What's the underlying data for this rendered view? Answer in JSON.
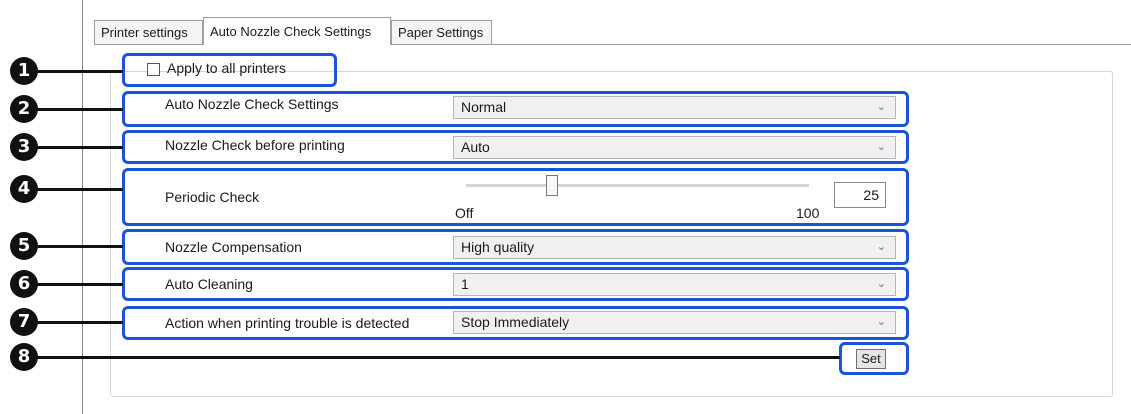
{
  "tabs": [
    {
      "label": "Printer settings",
      "active": false
    },
    {
      "label": "Auto Nozzle Check Settings",
      "active": true
    },
    {
      "label": "Paper Settings",
      "active": false
    }
  ],
  "apply_all": {
    "label": "Apply to all printers",
    "checked": false
  },
  "rows": {
    "auto_nozzle": {
      "label": "Auto Nozzle Check Settings",
      "value": "Normal"
    },
    "nozzle_check": {
      "label": "Nozzle Check before printing",
      "value": "Auto"
    },
    "periodic": {
      "label": "Periodic Check",
      "value": "25",
      "min_label": "Off",
      "max_label": "100",
      "slider_fraction": 0.25
    },
    "compensation": {
      "label": "Nozzle Compensation",
      "value": "High quality"
    },
    "cleaning": {
      "label": "Auto Cleaning",
      "value": "1"
    },
    "trouble": {
      "label": "Action when printing trouble is detected",
      "value": "Stop Immediately"
    }
  },
  "set_button": {
    "label": "Set"
  },
  "callouts": [
    "1",
    "2",
    "3",
    "4",
    "5",
    "6",
    "7",
    "8"
  ],
  "icons": {
    "chevron": "chevron-down-icon"
  },
  "colors": {
    "highlight": "#1b54d8",
    "callout": "#111111"
  }
}
